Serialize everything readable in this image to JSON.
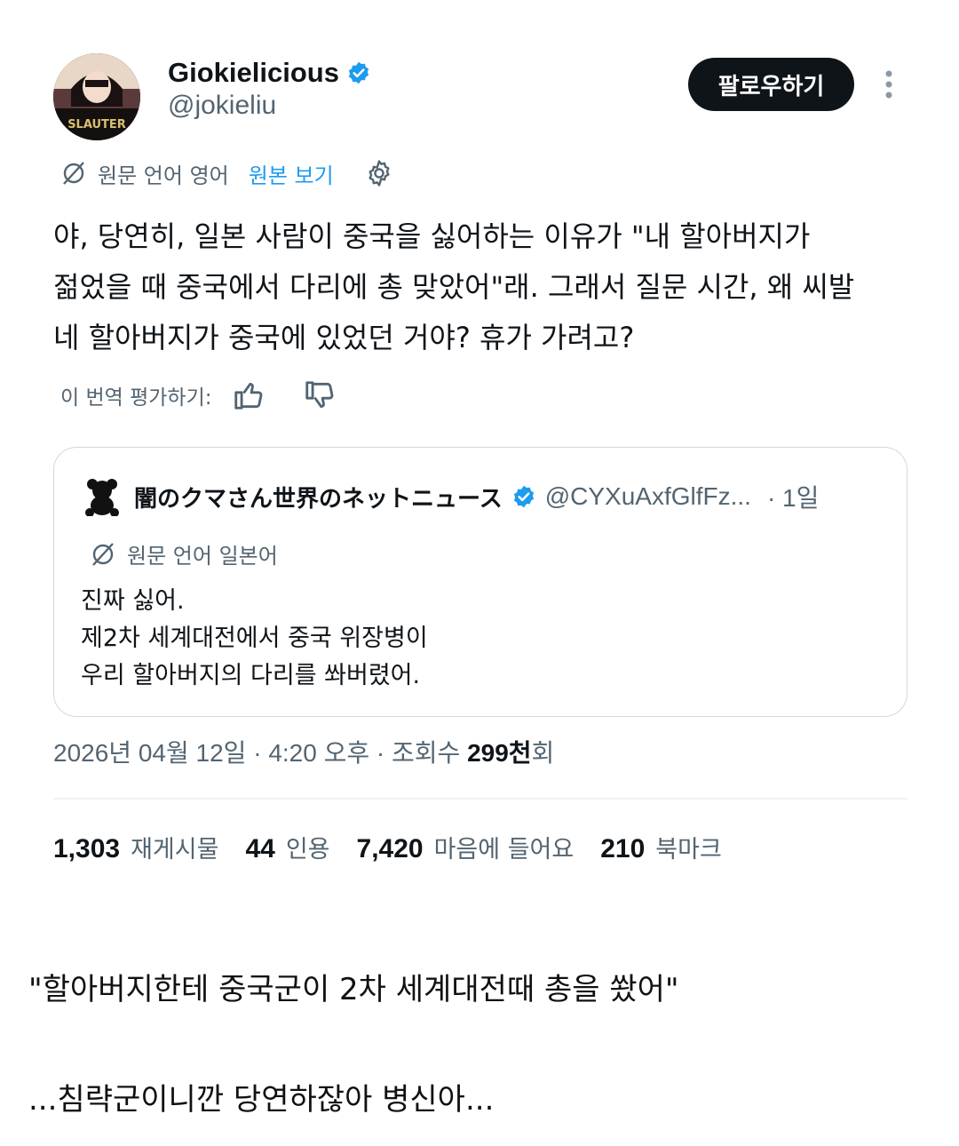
{
  "author": {
    "display_name": "Giokielicious",
    "handle": "@jokieliu",
    "avatar_text": "SLAUTER",
    "verified_icon": "verified-badge-icon",
    "verified_color": "#1d9bf0"
  },
  "header": {
    "follow_label": "팔로우하기",
    "more_icon": "more-vertical-icon"
  },
  "translation": {
    "source_language": "원문 언어 영어",
    "view_original": "원본 보기",
    "settings_icon": "gear-icon"
  },
  "tweet": {
    "text": "야, 당연히, 일본 사람이 중국을 싫어하는 이유가 \"내 할아버지가\n젊었을 때 중국에서 다리에 총 맞았어\"래. 그래서 질문 시간, 왜 씨발\n네 할아버지가 중국에 있었던 거야? 휴가 가려고?"
  },
  "rating": {
    "label": "이 번역 평가하기:",
    "thumbs_up_icon": "thumbs-up-icon",
    "thumbs_down_icon": "thumbs-down-icon"
  },
  "quote": {
    "author_name": "闇のクマさん世界のネットニュース",
    "author_handle": "@CYXuAxfGlfFz...",
    "time": "· 1일",
    "avatar_icon": "bear-icon",
    "source_language": "원문 언어 일본어",
    "text": "진짜 싫어.\n제2차 세계대전에서 중국 위장병이\n우리 할아버지의 다리를 쏴버렸어."
  },
  "meta": {
    "date": "2026년 04월 12일",
    "time": "4:20 오후",
    "views_label": "조회수",
    "views_value": "299천",
    "views_suffix": "회"
  },
  "stats": [
    {
      "num": "1,303",
      "label": "재게시물"
    },
    {
      "num": "44",
      "label": "인용"
    },
    {
      "num": "7,420",
      "label": "마음에 들어요"
    },
    {
      "num": "210",
      "label": "북마크"
    }
  ],
  "captions": {
    "line1": "\"할아버지한테 중국군이 2차 세계대전때 총을 쐈어\"",
    "line2": "...침략군이니깐 당연하잖아 병신아..."
  }
}
